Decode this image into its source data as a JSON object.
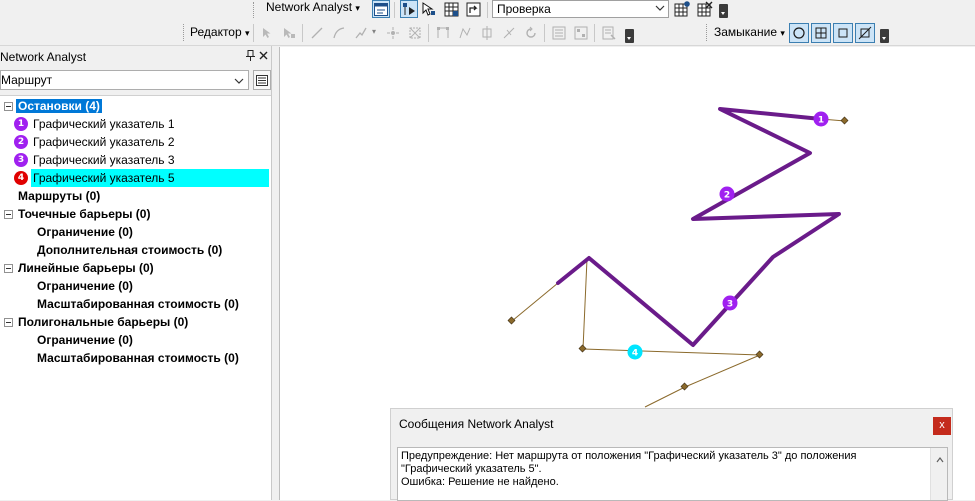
{
  "toolbar1": {
    "network_analyst_label": "Network Analyst",
    "solver_combo_value": "Проверка"
  },
  "toolbar2": {
    "editor_label": "Редактор",
    "snapping_label": "Замыкание"
  },
  "panel": {
    "title": "Network Analyst",
    "layer_combo_value": "Маршрут",
    "tree": {
      "stops_label": "Остановки (4)",
      "stops": [
        {
          "number": "1",
          "label": "Графический указатель 1"
        },
        {
          "number": "2",
          "label": "Графический указатель 2"
        },
        {
          "number": "3",
          "label": "Графический указатель 3"
        },
        {
          "number": "4",
          "label": "Графический указатель 5"
        }
      ],
      "routes_label": "Маршруты (0)",
      "point_barriers_label": "Точечные барьеры (0)",
      "point_restriction_label": "Ограничение (0)",
      "point_added_cost_label": "Дополнительная стоимость (0)",
      "line_barriers_label": "Линейные барьеры (0)",
      "line_restriction_label": "Ограничение (0)",
      "line_scaled_cost_label": "Масштабированная стоимость (0)",
      "polygon_barriers_label": "Полигональные барьеры (0)",
      "polygon_restriction_label": "Ограничение (0)",
      "polygon_scaled_cost_label": "Масштабированная стоимость (0)"
    }
  },
  "map": {
    "stop_labels": [
      "1",
      "2",
      "3",
      "4"
    ]
  },
  "messages": {
    "title": "Сообщения Network Analyst",
    "close_label": "x",
    "lines": [
      "Предупреждение: Нет маршрута от положения \"Графический указатель 3\" до положения",
      "\"Графический указатель 5\".",
      "Ошибка: Решение не найдено."
    ]
  },
  "colors": {
    "route": "#6a1b8a",
    "stop_badge": "#a020f0",
    "error_stop_badge": "#e00000",
    "unlocated_stop": "#00e5ff",
    "network_line": "#8b6a2c",
    "selection_blue": "#0078d7",
    "selection_cyan": "#00ffff"
  }
}
